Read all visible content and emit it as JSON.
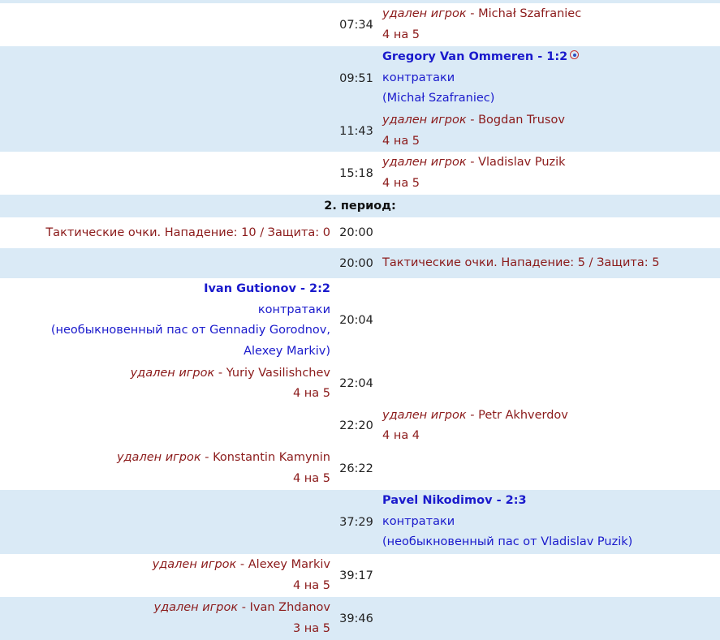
{
  "period2_label": "2. период:",
  "rows": {
    "r1": {
      "time": "07:34",
      "pen_label": "удален игрок",
      "sep": " - ",
      "player": "Michał Szafraniec",
      "sit": "4 на 5"
    },
    "r2": {
      "time": "09:51",
      "scorer": "Gregory Van Ommeren - 1:2",
      "icon": "target-icon",
      "type": "контратаки",
      "assist": "(Michał Szafraniec)"
    },
    "r3": {
      "time": "11:43",
      "pen_label": "удален игрок",
      "sep": " - ",
      "player": "Bogdan Trusov",
      "sit": "4 на 5"
    },
    "r4": {
      "time": "15:18",
      "pen_label": "удален игрок",
      "sep": " - ",
      "player": "Vladislav Puzik",
      "sit": "4 на 5"
    },
    "r5": {
      "time": "20:00",
      "text": "Тактические очки. Нападение: 10 / Защита: 0"
    },
    "r6": {
      "time": "20:00",
      "text": "Тактические очки. Нападение: 5 / Защита: 5"
    },
    "r7": {
      "time": "20:04",
      "scorer": "Ivan Gutionov - 2:2",
      "type": "контратаки",
      "assist": "(необыкновенный пас от Gennadiy Gorodnov, Alexey Markiv)"
    },
    "r8": {
      "time": "22:04",
      "pen_label": "удален игрок",
      "sep": " - ",
      "player": "Yuriy Vasilishchev",
      "sit": "4 на 5"
    },
    "r9": {
      "time": "22:20",
      "pen_label": "удален игрок",
      "sep": " - ",
      "player": "Petr Akhverdov",
      "sit": "4 на 4"
    },
    "r10": {
      "time": "26:22",
      "pen_label": "удален игрок",
      "sep": " - ",
      "player": "Konstantin Kamynin",
      "sit": "4 на 5"
    },
    "r11": {
      "time": "37:29",
      "scorer": "Pavel Nikodimov - 2:3",
      "type": "контратаки",
      "assist": "(необыкновенный пас от Vladislav Puzik)"
    },
    "r12": {
      "time": "39:17",
      "pen_label": "удален игрок",
      "sep": " - ",
      "player": "Alexey Markiv",
      "sit": "4 на 5"
    },
    "r13": {
      "time": "39:46",
      "pen_label": "удален игрок",
      "sep": " - ",
      "player": "Ivan Zhdanov",
      "sit": "3 на 5"
    }
  },
  "colors": {
    "row_alt": "#daeaf6",
    "goal": "#1a1acc",
    "penalty": "#8b1a1a"
  }
}
